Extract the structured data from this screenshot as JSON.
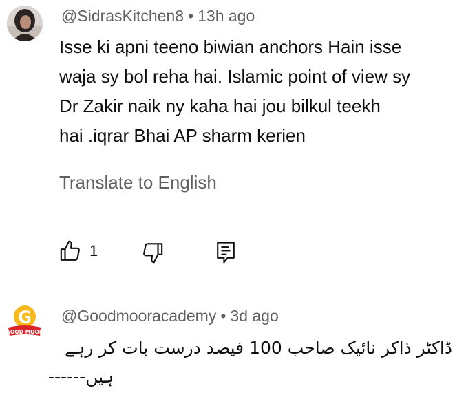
{
  "comments": [
    {
      "author": "@SidrasKitchen8",
      "time": "13h ago",
      "separator": "•",
      "text_lines": [
        "Isse ki apni teeno biwian anchors Hain isse",
        "waja sy bol reha hai. Islamic point of view sy",
        "Dr Zakir naik ny kaha hai jou bilkul teekh",
        "hai .iqrar Bhai AP sharm kerien"
      ],
      "translate_label": "Translate to English",
      "like_count": "1",
      "icons": [
        "like-icon",
        "dislike-icon",
        "reply-icon"
      ]
    },
    {
      "author": "@Goodmooracademy",
      "time": "3d ago",
      "separator": "•",
      "avatar_text": "GOOD MOON",
      "text_lines": [
        "ڈاکٹر ذاکر نائیک صاحب 100 فیصد درست بات کر رہے",
        "ہیں------"
      ]
    }
  ],
  "colors": {
    "primary_text": "#0f0f0f",
    "secondary_text": "#606060",
    "background": "#ffffff",
    "brand_yellow": "#f6b81a",
    "brand_red": "#d9252a"
  }
}
